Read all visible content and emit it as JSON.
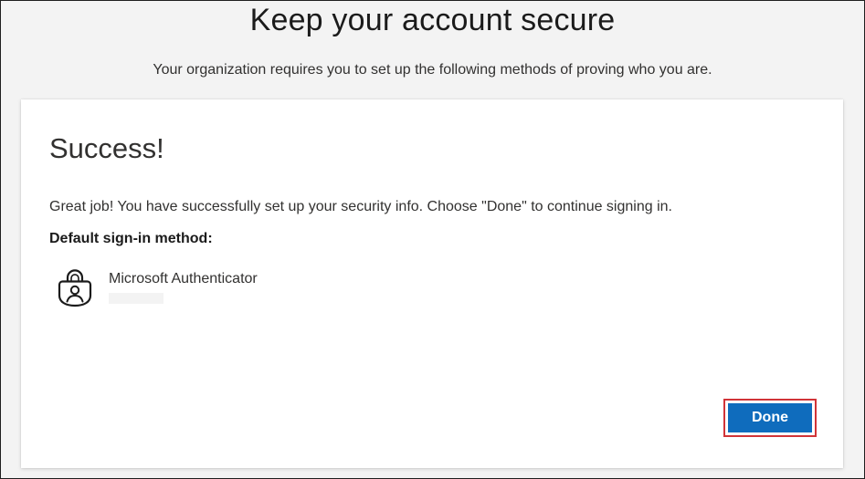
{
  "page": {
    "title": "Keep your account secure",
    "subtitle": "Your organization requires you to set up the following methods of proving who you are."
  },
  "card": {
    "title": "Success!",
    "description": "Great job! You have successfully set up your security info. Choose \"Done\" to continue signing in.",
    "method_label": "Default sign-in method:",
    "method": {
      "name": "Microsoft Authenticator",
      "icon": "authenticator-lock-icon"
    },
    "done_label": "Done"
  },
  "colors": {
    "background": "#f3f3f3",
    "card": "#ffffff",
    "primary_button": "#0f6cbd",
    "highlight_border": "#d13438",
    "text": "#323130"
  }
}
